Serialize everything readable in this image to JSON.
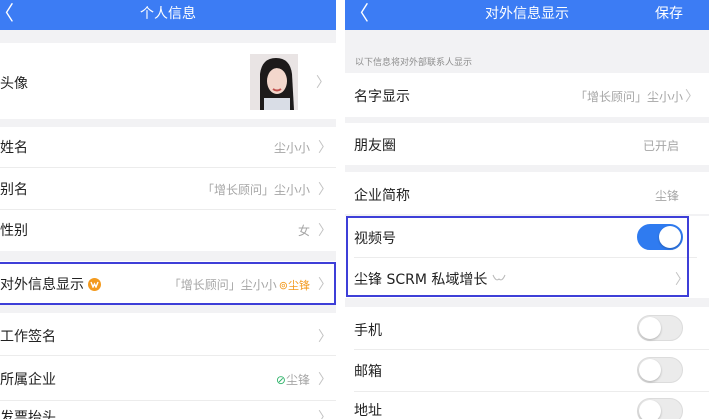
{
  "left": {
    "nav_title": "个人信息",
    "back_glyph": "〈",
    "rows": {
      "avatar": {
        "label": "头像"
      },
      "name": {
        "label": "姓名",
        "value": "尘小小"
      },
      "alias": {
        "label": "别名",
        "value": "「增长顾问」尘小小"
      },
      "gender": {
        "label": "性别",
        "value": "女"
      },
      "external": {
        "label": "对外信息显示",
        "value": "「增长顾问」尘小小",
        "org": "尘锋"
      },
      "signature": {
        "label": "工作签名"
      },
      "company": {
        "label": "所属企业",
        "value": "尘锋"
      },
      "invoice": {
        "label": "发票抬头"
      }
    }
  },
  "right": {
    "nav_title": "对外信息显示",
    "save_label": "保存",
    "back_glyph": "〈",
    "hint": "以下信息将对外部联系人显示",
    "rows": {
      "display_name": {
        "label": "名字显示",
        "value": "「增长顾问」尘小小"
      },
      "moments": {
        "label": "朋友圈",
        "value": "已开启"
      },
      "company_short": {
        "label": "企业简称",
        "value": "尘锋"
      },
      "channels": {
        "label": "视频号",
        "enabled": true
      },
      "scrm": {
        "label": "尘锋 SCRM 私域增长"
      },
      "phone": {
        "label": "手机",
        "enabled": false
      },
      "email": {
        "label": "邮箱",
        "enabled": false
      },
      "address": {
        "label": "地址",
        "enabled": false
      }
    }
  },
  "chevron": "〉",
  "colors": {
    "navbar": "#3c7cf4",
    "toggle_on": "#2f7bf0",
    "highlight_border": "#3e3fd8",
    "badge": "#f39a1e",
    "verified": "#2fb36a"
  }
}
